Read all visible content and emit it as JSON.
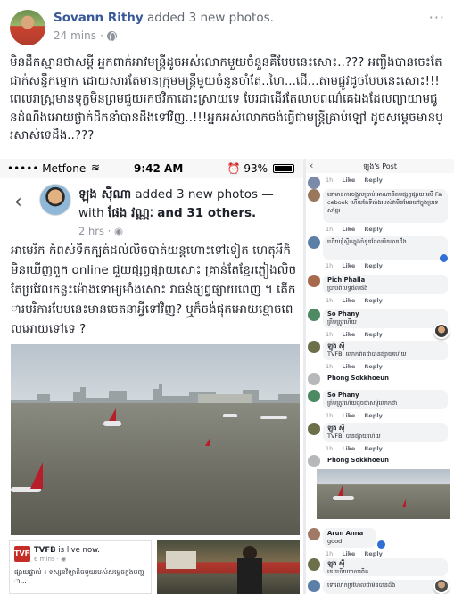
{
  "post": {
    "author": "Sovann Rithy",
    "action": "added 3 new photos.",
    "time": "24 mins",
    "dot": "·",
    "more": "···",
    "caption": "មិនដឹកស្មានថាសម្តី អ្នកពាក់អាវមន្ត្រីដូចអស់លោកមួយចំនួនគឺបែបនេះសោះ..??? អញ្ចឹងបានចេះតែជាក់សន្ទឹកម្នោក ដោយសារតែមានក្រុមមន្ត្រីមួយចំនួនចាំតែ..ហៃ...ជើ...តាមផ្លូវដូចបែបនេះសោះ!!!ពេលរាស្ត្រមានទុក្ខមិនព្រមជួយរកថវិកាដោះស្រាយទេ បែរជាដើរតែលាបពណ៌គេឯងដែលព្យាយាមជូនដំណឹងអោយផ្លាក់ដឹកនាំបានដឹងទៅវិញ..!!!អ្នកអស់លោកចង់ធ្វើជាមន្ត្រីគ្រាប់ឡៅ ដូចសម្តេចមានប្រសាស់ទេដឹង..???"
  },
  "phone": {
    "carrier": "••••• Metfone",
    "wifi": "≋",
    "time": "9:42 AM",
    "battery": "⏰ 93%",
    "back": "‹",
    "author_name": "ឡុង ស៊ីណា",
    "author_action": "added 3 new photos — with",
    "tagged": "ផែង វណ្ណៈ",
    "tagged_suffix": "and 31 others.",
    "meta": "2 hrs · ◉",
    "text": "អាមេរិក កំពស់ទឹកក្បត់ដល់លិចបាត់យន្តហោះទៅទៀត ហេតុអីក៏មិនឃើញពួក online ជួយផ្សព្វផ្សាយសោះ គ្រាន់តែខ្មែរភ្លៀងលិចតែប្រវែលកន្លះម៉ោងទោម្យមាំងសោះ វាធន់ផ្សព្វផ្សាយពេញ ។ តើការបរិការបែបនេះមានចេតនាអ្វីទៅវិញ? ឬក៏ចង់ផុតអោយខ្មោចពេលអោយទៅទេ ?",
    "live_logo": "TVFB",
    "live_name": "TVFB",
    "live_action": "is live now.",
    "live_time": "6 mins · ◉",
    "live_desc": "ផ្សាយផ្ទាល់ ៖ ទស្សនវិទ្យាតិចមួយរបស់សម្តេចក្នុងបញ្ហា..."
  },
  "thread": {
    "back": "‹",
    "title": "ឡុង's Post",
    "like": "Like",
    "reply": "Reply",
    "comments": [
      {
        "name": "",
        "text": "",
        "time": "1h"
      },
      {
        "name": "",
        "text": "នៅមានការចង្អុលប្រាប់ អាណានិគមផ្សព្វផ្សាយ លើ Facebook ហើយតែទីតាំងរបស់វាមិនមែននៅក្នុងប្រទេសខ្មែរ",
        "time": "1h"
      },
      {
        "name": "",
        "text": "ហើយខ្ញុំស្ថិតក្នុងចំនួនដែលមិនបានដឹង",
        "time": "1h"
      },
      {
        "name": "Pich Phalla",
        "text": "ប្រាប់ពីលទ្ធផលផង",
        "time": "1h"
      },
      {
        "name": "So Phany",
        "text": "ត្រឹមត្រូវហើយ",
        "time": "1h"
      },
      {
        "name": "ឡុង ស៊ី",
        "text": "TVFB, លោកពិតជាបានផ្សាយហើយ",
        "time": "1h"
      },
      {
        "name": "Phong Sokkhoeun",
        "text": "",
        "time": ""
      },
      {
        "name": "So Phany",
        "text": "ត្រឹមត្រូវហើយដូចជាសម្តីលោកថា",
        "time": "1h"
      },
      {
        "name": "ឡុង ស៊ី",
        "text": "TVFB, បានផ្សាយហើយ",
        "time": "1h"
      },
      {
        "name": "Phong Sokkhoeun",
        "text": "",
        "time": ""
      },
      {
        "name": "Arun Anna",
        "text": "good",
        "time": "1h"
      },
      {
        "name": "ឡុង ស៊ី",
        "text": "នេះហើយជាការពិត",
        "time": "1h"
      },
      {
        "name": "",
        "text": "ទៅលោកប្រហែលជាមិនបានដឹង",
        "time": "1h"
      }
    ]
  }
}
